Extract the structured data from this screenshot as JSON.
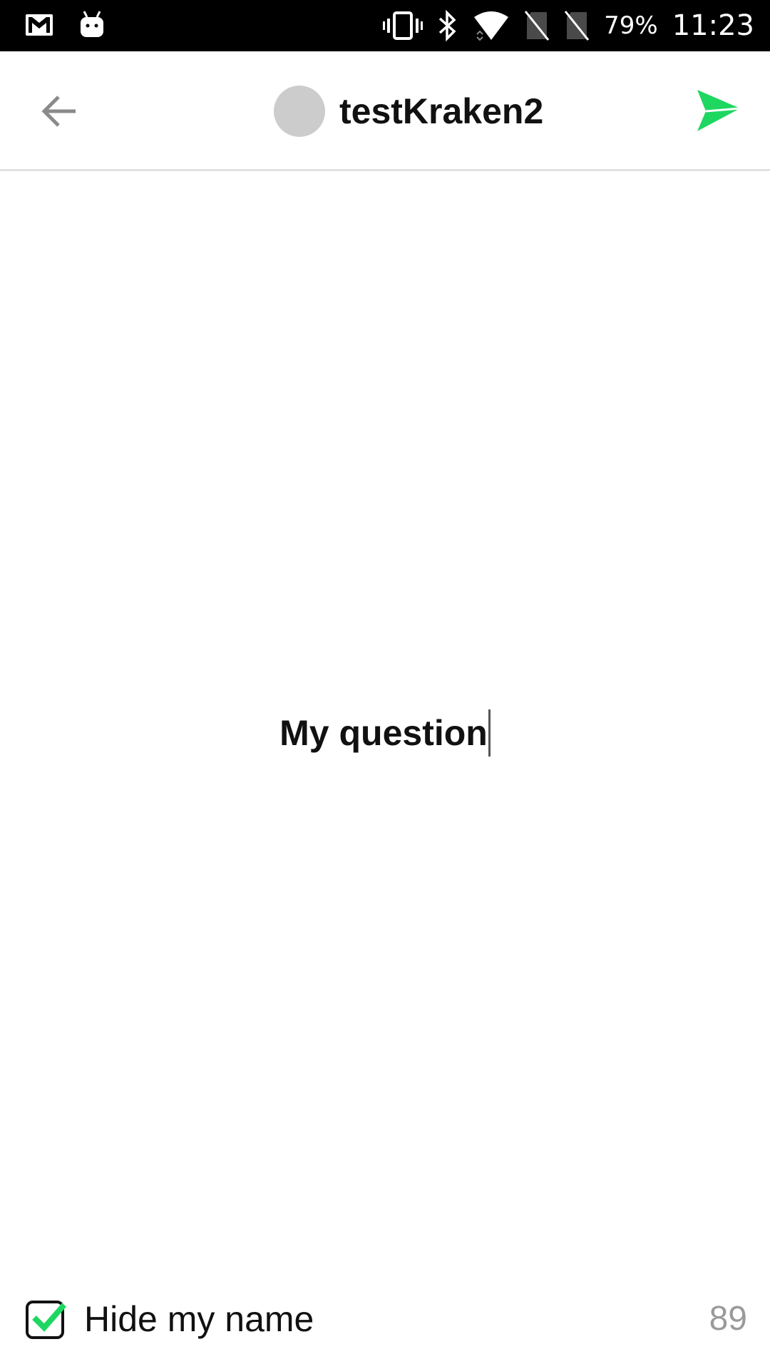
{
  "status_bar": {
    "left_icons": [
      "gmail-icon",
      "android-icon"
    ],
    "right_icons": [
      "vibrate-icon",
      "bluetooth-icon",
      "wifi-icon",
      "no-sim-icon",
      "no-sim-icon"
    ],
    "battery": "79%",
    "time": "11:23"
  },
  "header": {
    "back_icon": "arrow-left-icon",
    "title": "testKraken2",
    "avatar_color": "#cccccc",
    "send_icon": "send-icon",
    "send_color": "#1ed760"
  },
  "question": {
    "text": "My question"
  },
  "footer": {
    "hide_name_label": "Hide my name",
    "hide_name_checked": true,
    "check_color": "#1ed760",
    "char_count": "89"
  }
}
